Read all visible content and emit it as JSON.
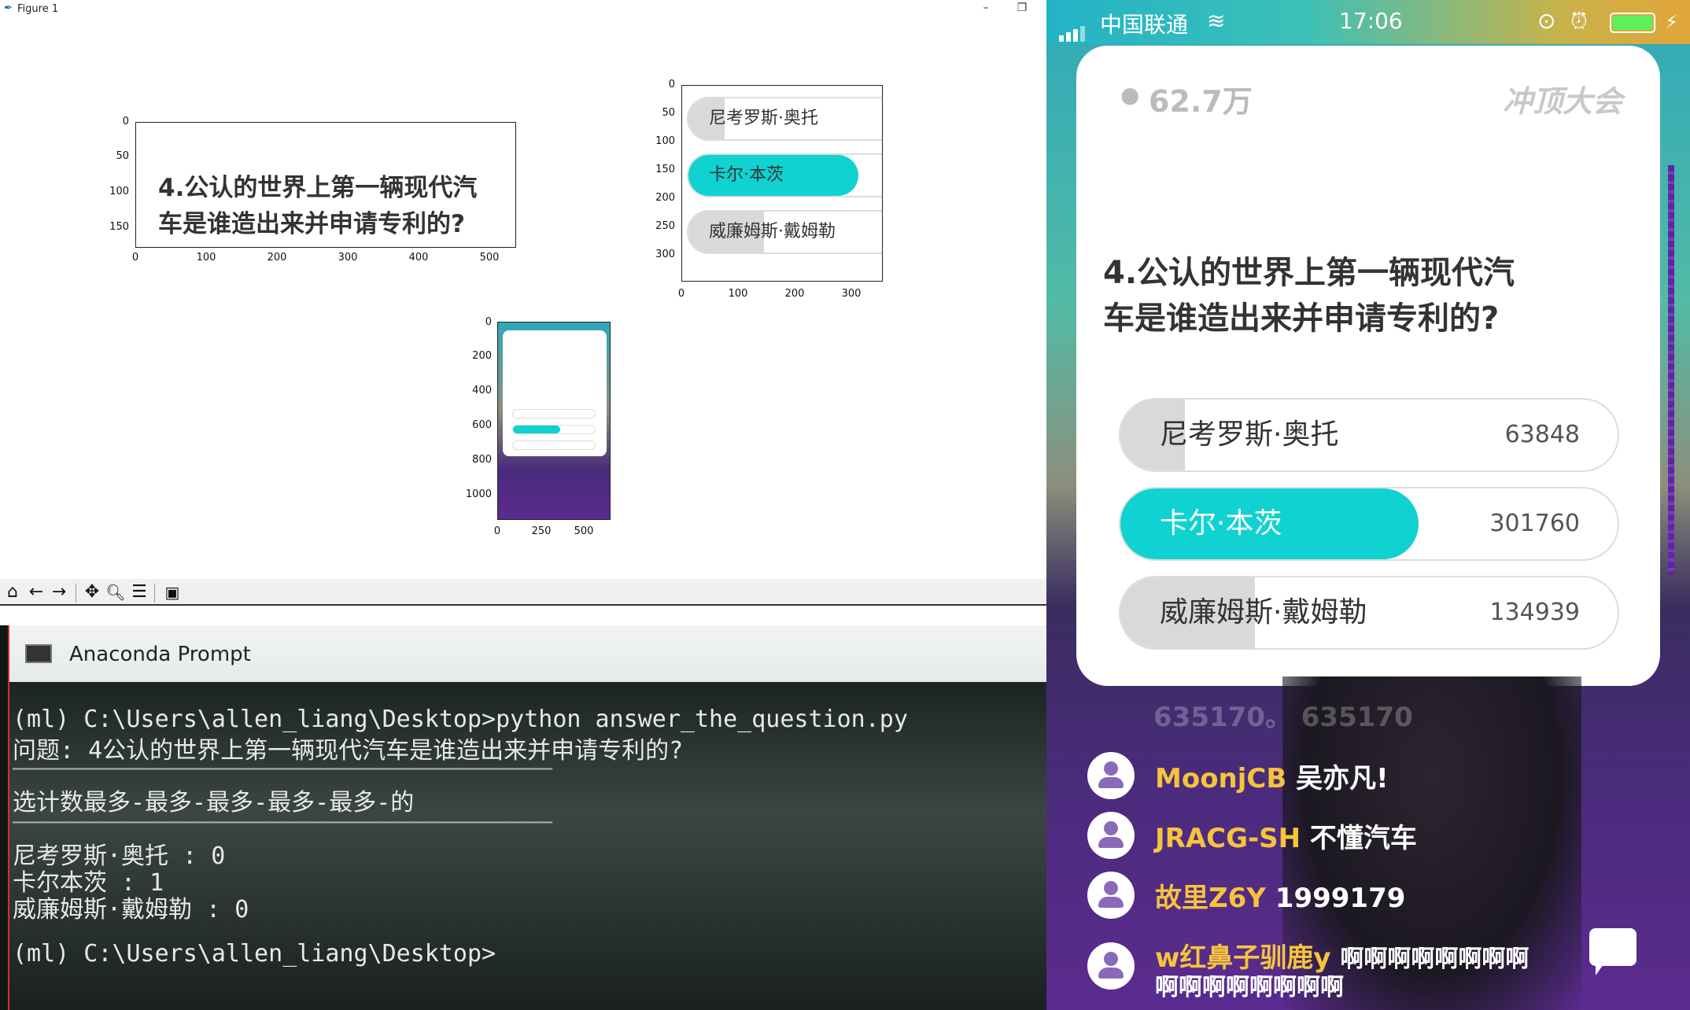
{
  "window": {
    "title": "Figure 1",
    "minimize_icon": "minimize-icon",
    "restore_icon": "restore-icon"
  },
  "plot1": {
    "y_ticks": [
      "0",
      "50",
      "100",
      "150"
    ],
    "x_ticks": [
      "0",
      "100",
      "200",
      "300",
      "400",
      "500"
    ],
    "question_line1": "4.公认的世界上第一辆现代汽",
    "question_line2": "车是谁造出来并申请专利的?"
  },
  "plot2": {
    "y_ticks": [
      "0",
      "50",
      "100",
      "150",
      "200",
      "250",
      "300"
    ],
    "x_ticks": [
      "0",
      "100",
      "200",
      "300"
    ],
    "options": [
      "尼考罗斯·奥托",
      "卡尔·本茨",
      "威廉姆斯·戴姆勒"
    ]
  },
  "plot3": {
    "y_ticks": [
      "0",
      "200",
      "400",
      "600",
      "800",
      "1000"
    ],
    "x_ticks": [
      "0",
      "250",
      "500"
    ]
  },
  "toolbar": {
    "icons": [
      "home-icon",
      "back-icon",
      "forward-icon",
      "pan-icon",
      "zoom-icon",
      "configure-icon",
      "save-icon"
    ]
  },
  "prompt": {
    "title": "Anaconda Prompt",
    "lines": [
      "(ml) C:\\Users\\allen_liang\\Desktop>python answer_the_question.py",
      "问题: 4公认的世界上第一辆现代汽车是谁造出来并申请专利的?",
      "——————————————————————————————————————",
      "选计数最多-最多-最多-最多-最多-的",
      "——————————————————————————————————————",
      "尼考罗斯·奥托 : 0",
      "卡尔本茨 : 1",
      "威廉姆斯·戴姆勒 : 0",
      "(ml) C:\\Users\\allen_liang\\Desktop>"
    ]
  },
  "phone": {
    "carrier": "中国联通",
    "time": "17:06",
    "viewers": "62.7万",
    "brand": "冲顶大会",
    "question_line1": "4.公认的世界上第一辆现代汽",
    "question_line2": "车是谁造出来并申请专利的?",
    "options": [
      {
        "label": "尼考罗斯·奥托",
        "count": "63848",
        "fill_fraction": 0.13,
        "color": "#d9d9d9"
      },
      {
        "label": "卡尔·本茨",
        "count": "301760",
        "fill_fraction": 0.6,
        "color": "#10d2d0"
      },
      {
        "label": "威廉姆斯·戴姆勒",
        "count": "134939",
        "fill_fraction": 0.27,
        "color": "#d9d9d9"
      }
    ],
    "faded_comment": "635170。 635170",
    "comments": [
      {
        "user": "MoonjCB",
        "msg": "吴亦凡!"
      },
      {
        "user": "JRACG-SH",
        "msg": "不懂汽车"
      },
      {
        "user": "故里Z6Y",
        "msg": "1999179"
      },
      {
        "user": "w红鼻子驯鹿y",
        "msg": "啊啊啊啊啊啊啊啊",
        "msg2": "啊啊啊啊啊啊啊啊"
      }
    ],
    "accent_color": "#10d2d0",
    "username_color": "#f5c43b"
  }
}
